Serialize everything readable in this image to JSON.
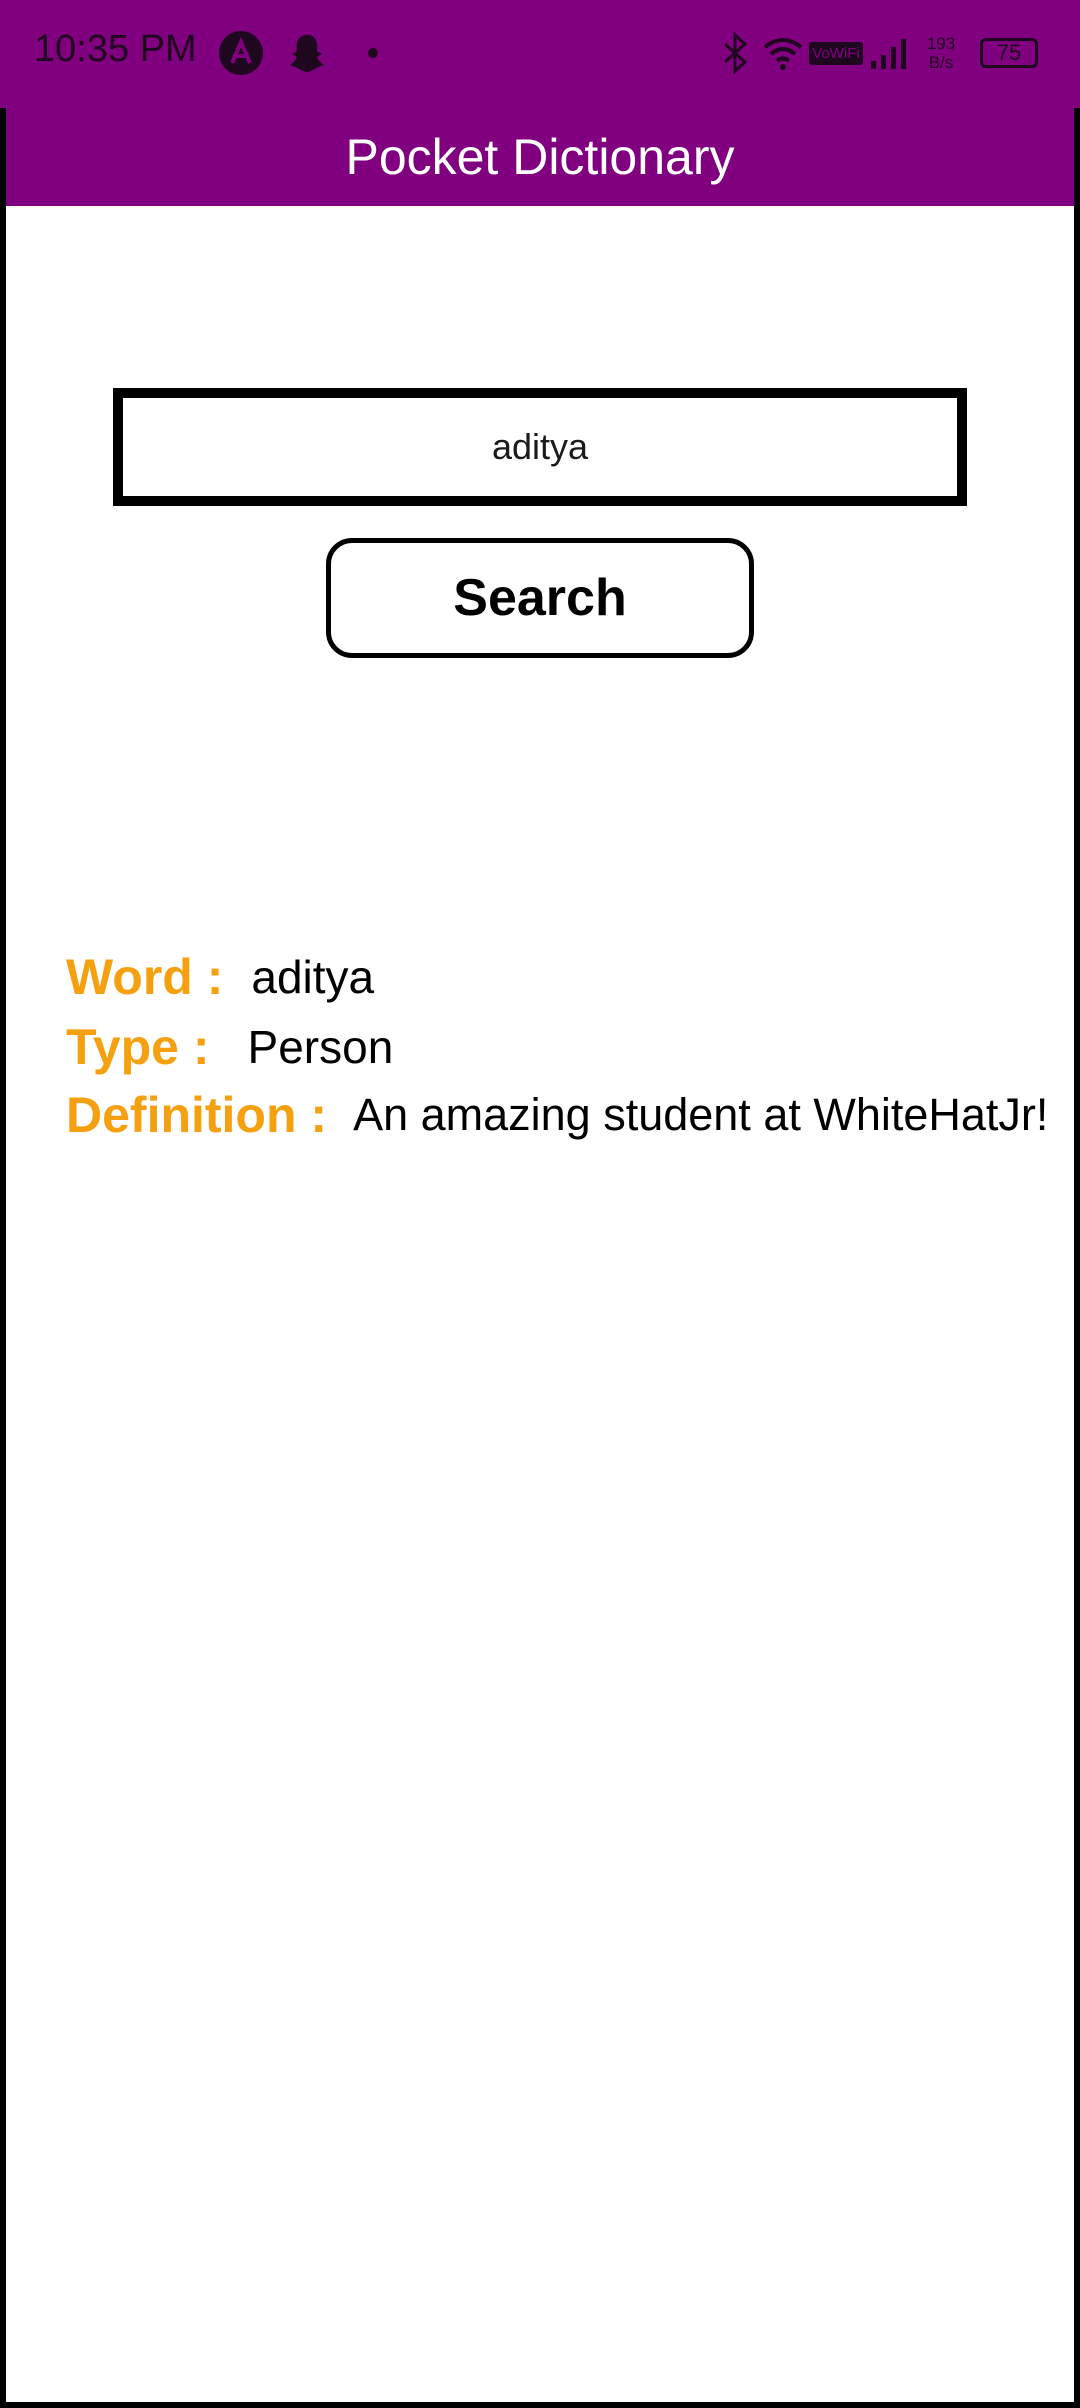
{
  "status_bar": {
    "time": "10:35 PM",
    "icons": [
      "a-app-icon",
      "snapchat-icon",
      "dot-icon",
      "bluetooth-icon",
      "wifi-icon",
      "vowifi-icon",
      "signal-icon",
      "data-speed",
      "battery-icon"
    ],
    "vowifi_label": "VoWiFi",
    "data_speed_value": "193",
    "data_speed_unit": "B/s",
    "battery_level": "75"
  },
  "app_bar": {
    "title": "Pocket Dictionary",
    "color": "#800080"
  },
  "search": {
    "input_value": "aditya",
    "button_label": "Search"
  },
  "result": {
    "word_label": "Word :",
    "word_value": "aditya",
    "type_label": "Type :",
    "type_value": "Person",
    "definition_label": "Definition :",
    "definition_value": "An amazing student at WhiteHatJr!",
    "label_color": "#f5a10f"
  }
}
